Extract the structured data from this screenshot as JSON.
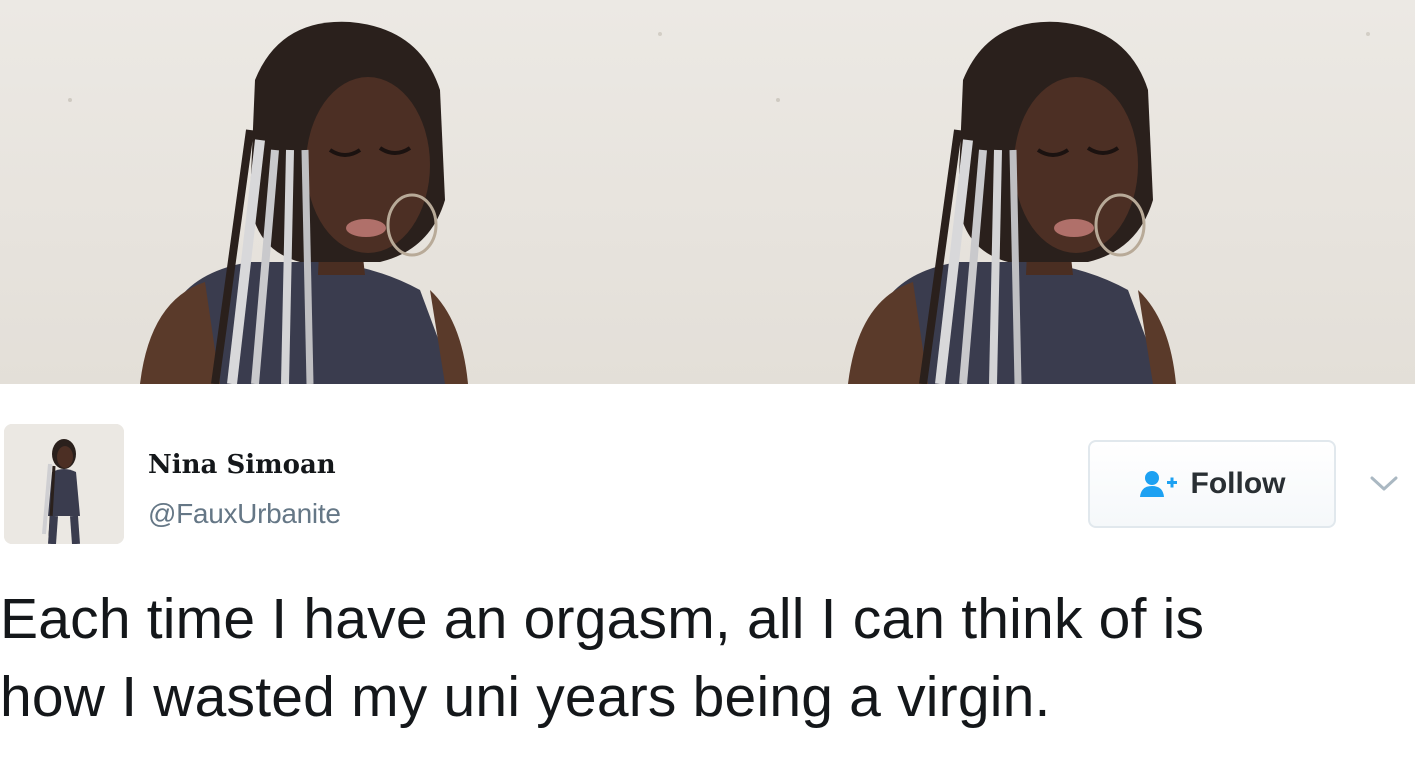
{
  "photos": [
    {
      "icon": "profile-photo"
    },
    {
      "icon": "profile-photo"
    }
  ],
  "user": {
    "display_name": "Nina Simoan",
    "screen_name": "@FauxUrbanite",
    "avatar_icon": "avatar-photo"
  },
  "follow_button": {
    "label": "Follow",
    "icon": "add-user-icon",
    "accent_color": "#1da1f2"
  },
  "menu": {
    "icon": "chevron-down-icon"
  },
  "tweet": {
    "lines": [
      "Each time I have an orgasm, all I can think of is",
      "how I wasted my uni years being a virgin."
    ]
  },
  "colors": {
    "text": "#14171a",
    "secondary": "#657786",
    "border": "#e1e8ed"
  }
}
